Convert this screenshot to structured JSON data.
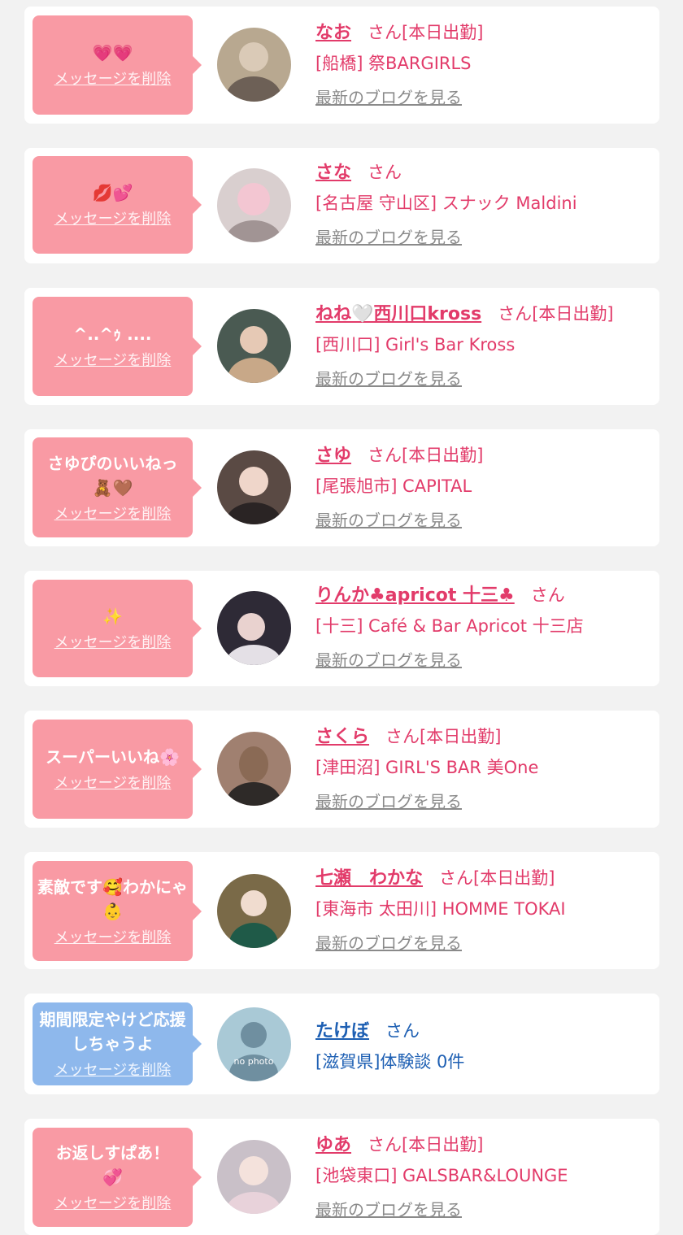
{
  "common": {
    "delete_label": "メッセージを削除",
    "blog_label": "最新のブログを見る",
    "san_label": "さん",
    "work_label": "[本日出勤]"
  },
  "items": [
    {
      "message": "💗💗",
      "name": "なお",
      "shop": "[船橋] 祭BARGIRLS",
      "working": true,
      "theme": "pink",
      "avatar_color": "#b8a890"
    },
    {
      "message": "💋💕",
      "name": "さな",
      "shop": "[名古屋 守山区] スナック Maldini",
      "working": false,
      "theme": "pink",
      "avatar_color": "#d9cfcf"
    },
    {
      "message": "^..^ｩ ....",
      "name": "ねね🤍西川口kross",
      "shop": "[西川口] Girl's Bar Kross",
      "working": true,
      "theme": "pink",
      "avatar_color": "#4a5a52"
    },
    {
      "message": "さゆぴのいいねっ\n🧸🤎",
      "name": "さゆ",
      "shop": "[尾張旭市] CAPITAL",
      "working": true,
      "theme": "pink",
      "avatar_color": "#5a4a44"
    },
    {
      "message": "✨",
      "name": "りんか♣apricot 十三♣",
      "shop": "[十三] Café & Bar Apricot 十三店",
      "working": false,
      "theme": "pink",
      "avatar_color": "#2e2a36"
    },
    {
      "message": "スーパーいいね🌸",
      "name": "さくら",
      "shop": "[津田沼] GIRL'S BAR 美One",
      "working": true,
      "theme": "pink",
      "avatar_color": "#a08070"
    },
    {
      "message": "素敵です🥰わかにゃ👶",
      "name": "七瀬　わかな",
      "shop": "[東海市 太田川] HOMME TOKAI",
      "working": true,
      "theme": "pink",
      "avatar_color": "#7a6a48"
    },
    {
      "message": "期間限定やけど応援しちゃうよ",
      "name": "たけぼ",
      "shop": "[滋賀県]体験談 0件",
      "working": false,
      "theme": "blue",
      "avatar_color": "#a9c9d6",
      "avatar_text": "no photo"
    },
    {
      "message": "お返しすぱあ！\n💞",
      "name": "ゆあ",
      "shop": "[池袋東口] GALSBAR&LOUNGE",
      "working": true,
      "theme": "pink",
      "avatar_color": "#c9c0c8"
    }
  ]
}
